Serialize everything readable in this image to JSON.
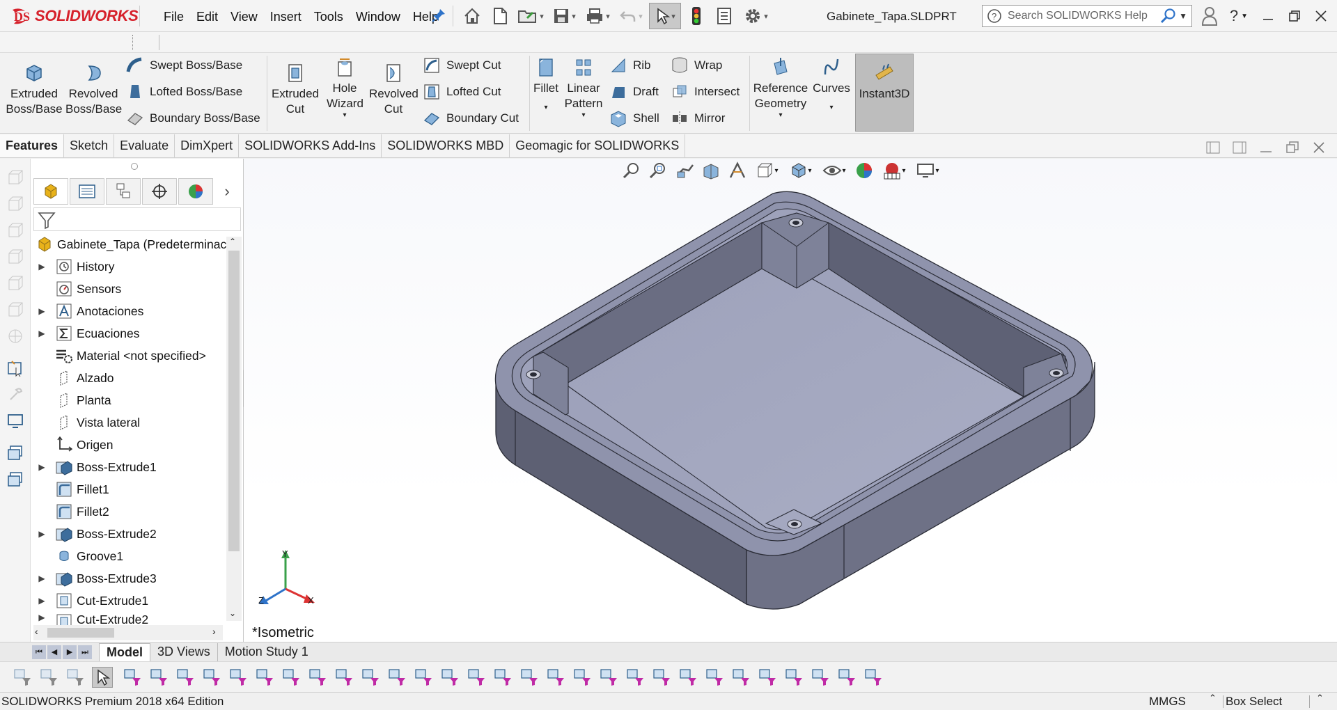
{
  "app": {
    "brand": "SOLIDWORKS",
    "document_title": "Gabinete_Tapa.SLDPRT"
  },
  "menu": [
    "File",
    "Edit",
    "View",
    "Insert",
    "Tools",
    "Window",
    "Help"
  ],
  "search": {
    "placeholder": "Search SOLIDWORKS Help"
  },
  "ribbon": {
    "extruded_boss": "Extruded Boss/Base",
    "revolved_boss": "Revolved Boss/Base",
    "swept_boss": "Swept Boss/Base",
    "lofted_boss": "Lofted Boss/Base",
    "boundary_boss": "Boundary Boss/Base",
    "extruded_cut": "Extruded Cut",
    "hole_wizard": "Hole Wizard",
    "revolved_cut": "Revolved Cut",
    "swept_cut": "Swept Cut",
    "lofted_cut": "Lofted Cut",
    "boundary_cut": "Boundary Cut",
    "fillet": "Fillet",
    "linear_pattern": "Linear Pattern",
    "rib": "Rib",
    "draft": "Draft",
    "shell": "Shell",
    "wrap": "Wrap",
    "intersect": "Intersect",
    "mirror": "Mirror",
    "reference_geometry": "Reference Geometry",
    "curves": "Curves",
    "instant3d": "Instant3D"
  },
  "command_tabs": [
    "Features",
    "Sketch",
    "Evaluate",
    "DimXpert",
    "SOLIDWORKS Add-Ins",
    "SOLIDWORKS MBD",
    "Geomagic for SOLIDWORKS"
  ],
  "tree": {
    "root": "Gabinete_Tapa  (Predeterminac",
    "items": [
      {
        "label": "History",
        "expandable": true,
        "icon": "history-icon"
      },
      {
        "label": "Sensors",
        "expandable": false,
        "icon": "sensor-icon"
      },
      {
        "label": "Anotaciones",
        "expandable": true,
        "icon": "annotation-icon"
      },
      {
        "label": "Ecuaciones",
        "expandable": true,
        "icon": "equation-icon"
      },
      {
        "label": "Material <not specified>",
        "expandable": false,
        "icon": "material-icon"
      },
      {
        "label": "Alzado",
        "expandable": false,
        "icon": "plane-icon"
      },
      {
        "label": "Planta",
        "expandable": false,
        "icon": "plane-icon"
      },
      {
        "label": "Vista lateral",
        "expandable": false,
        "icon": "plane-icon"
      },
      {
        "label": "Origen",
        "expandable": false,
        "icon": "origin-icon"
      },
      {
        "label": "Boss-Extrude1",
        "expandable": true,
        "icon": "boss-extrude-icon"
      },
      {
        "label": "Fillet1",
        "expandable": false,
        "icon": "fillet-icon"
      },
      {
        "label": "Fillet2",
        "expandable": false,
        "icon": "fillet-icon"
      },
      {
        "label": "Boss-Extrude2",
        "expandable": true,
        "icon": "boss-extrude-icon"
      },
      {
        "label": "Groove1",
        "expandable": false,
        "icon": "groove-icon"
      },
      {
        "label": "Boss-Extrude3",
        "expandable": true,
        "icon": "boss-extrude-icon"
      },
      {
        "label": "Cut-Extrude1",
        "expandable": true,
        "icon": "cut-extrude-icon"
      },
      {
        "label": "Cut-Extrude2",
        "expandable": true,
        "icon": "cut-extrude-icon"
      }
    ]
  },
  "viewport": {
    "view_label": "*Isometric",
    "triad": {
      "x": "X",
      "y": "Y",
      "z": "Z"
    }
  },
  "bottom_tabs": [
    "Model",
    "3D Views",
    "Motion Study 1"
  ],
  "status": {
    "edition": "SOLIDWORKS Premium 2018 x64 Edition",
    "units": "MMGS",
    "selection_mode": "Box Select"
  },
  "colors": {
    "brand_red": "#d6212b",
    "part_face": "#8a8ea8",
    "part_wall": "#5f6377",
    "active_tool": "#bdbdbd"
  }
}
